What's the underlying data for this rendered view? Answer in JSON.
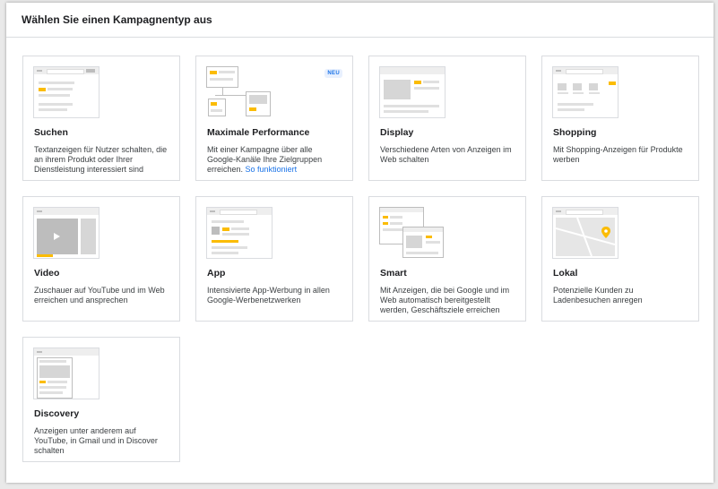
{
  "header": {
    "title": "Wählen Sie einen Kampagnentyp aus"
  },
  "cards": [
    {
      "title": "Suchen",
      "desc": "Textanzeigen für Nutzer schalten, die an ihrem Produkt oder Ihrer Dienstleistung interessiert sind"
    },
    {
      "title": "Maximale Performance",
      "desc": "Mit einer Kampagne über alle Google-Kanäle Ihre Zielgruppen erreichen.",
      "link": "So funktioniert",
      "badge": "NEU"
    },
    {
      "title": "Display",
      "desc": "Verschiedene Arten von Anzeigen im Web schalten"
    },
    {
      "title": "Shopping",
      "desc": "Mit Shopping-Anzeigen für Produkte werben"
    },
    {
      "title": "Video",
      "desc": "Zuschauer auf YouTube und im Web erreichen und ansprechen"
    },
    {
      "title": "App",
      "desc": "Intensivierte App-Werbung in allen Google-Werbenetzwerken"
    },
    {
      "title": "Smart",
      "desc": "Mit Anzeigen, die bei Google und im Web automatisch bereitgestellt werden, Geschäftsziele erreichen"
    },
    {
      "title": "Lokal",
      "desc": "Potenzielle Kunden zu Ladenbesuchen anregen"
    },
    {
      "title": "Discovery",
      "desc": "Anzeigen unter anderem auf YouTube, in Gmail und in Discover schalten"
    }
  ],
  "colors": {
    "accent": "#fbbc04",
    "link": "#1a73e8",
    "border": "#dadce0"
  },
  "icons": [
    "play-icon",
    "map-pin-icon"
  ]
}
